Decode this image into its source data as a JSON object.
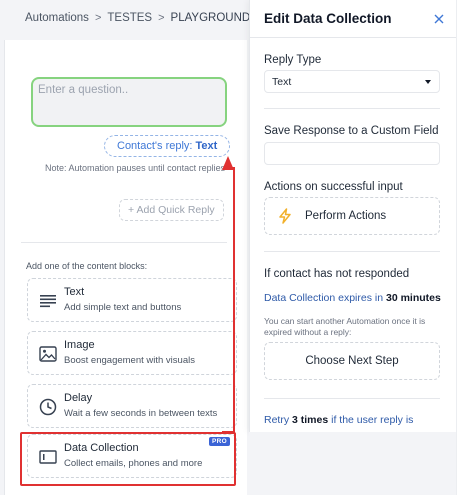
{
  "breadcrumb": {
    "items": [
      "Automations",
      "TESTES",
      "PLAYGROUND"
    ],
    "separator": ">"
  },
  "builder": {
    "question_placeholder": "Enter a question..",
    "reply_prefix": "Contact's reply:",
    "reply_type": "Text",
    "note": "Note: Automation pauses until contact replies",
    "quick_reply": "+ Add Quick Reply",
    "blocks_hint": "Add one of the content blocks:",
    "blocks": [
      {
        "title": "Text",
        "subtitle": "Add simple text and buttons",
        "icon": "text-lines-icon"
      },
      {
        "title": "Image",
        "subtitle": "Boost engagement with visuals",
        "icon": "image-icon"
      },
      {
        "title": "Delay",
        "subtitle": "Wait a few seconds in between texts",
        "icon": "clock-icon"
      },
      {
        "title": "Data Collection",
        "subtitle": "Collect emails, phones and more",
        "icon": "data-collection-icon",
        "badge": "PRO"
      }
    ]
  },
  "panel": {
    "title": "Edit Data Collection",
    "reply_type_label": "Reply Type",
    "reply_type_value": "Text",
    "save_label": "Save Response to a Custom Field",
    "save_value": "",
    "actions_label": "Actions on successful input",
    "perform_actions": "Perform Actions",
    "no_response_label": "If contact has not responded",
    "expires_prefix": "Data Collection expires in",
    "expires_value": "30 minutes",
    "expires_hint": "You can start another Automation once it is expired without a reply:",
    "next_step": "Choose Next Step",
    "retry_prefix": "Retry",
    "retry_value": "3 times",
    "retry_suffix": "if the user reply is"
  },
  "colors": {
    "accent_blue": "#3f78d6",
    "question_border": "#86d37f",
    "annotation_red": "#e03131",
    "bolt": "#f2b12c",
    "pro_badge": "#3b64d6"
  }
}
